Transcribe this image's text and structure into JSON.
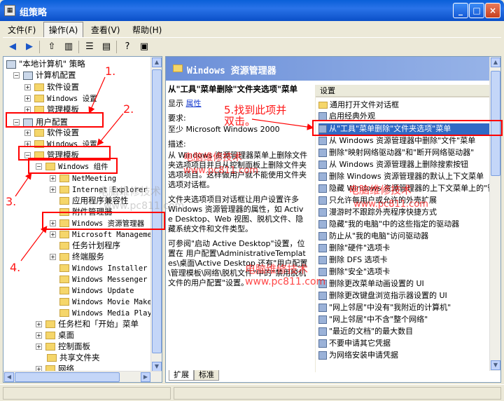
{
  "window": {
    "title": "组策略",
    "icon": "gpedit-icon",
    "min": "_",
    "max": "□",
    "close": "×"
  },
  "menu": [
    "文件(F)",
    "操作(A)",
    "查看(V)",
    "帮助(H)"
  ],
  "tree": {
    "root": "\"本地计算机\" 策略",
    "computer_config": "计算机配置",
    "software_settings_1": "软件设置",
    "windows_settings_1": "Windows 设置",
    "admin_templates_1": "管理模板",
    "user_config": "用户配置",
    "software_settings_2": "软件设置",
    "windows_settings_2": "Windows 设置",
    "admin_templates_2": "管理模板",
    "windows_components": "Windows 组件",
    "children": [
      "NetMeeting",
      "Internet Explorer",
      "应用程序兼容性",
      "附件管理器",
      "Windows 资源管理器",
      "Microsoft Management",
      "任务计划程序",
      "终端服务",
      "Windows Installer",
      "Windows Messenger",
      "Windows Update",
      "Windows Movie Maker",
      "Windows Media Player"
    ],
    "siblings": [
      "任务栏和「开始」菜单",
      "桌面",
      "控制面板",
      "共享文件夹",
      "网络"
    ]
  },
  "right": {
    "header": "Windows 资源管理器",
    "policy_title": "从\"工具\"菜单删除\"文件夹选项\"菜单",
    "show": "显示",
    "properties_link": "属性",
    "requirements_label": "要求:",
    "requirements": "至少 Microsoft Windows 2000",
    "description_label": "描述:",
    "description_1": "从 Windows 资源管理器菜单上删除文件夹选项项目并且从控制面板上删除文件夹选项项目。这样做用户就不能使用文件夹选项对话框。",
    "description_2": "文件夹选项项目对话框让用户设置许多 Windows 资源管理器的属性，如 Active Desktop、Web 视图、脱机文件、隐藏系统文件和文件类型。",
    "description_3": "可参阅\"启动 Active Desktop\"设置，位置在 用户配置\\AdministrativeTemplates\\桌面\\Active Desktop 还有\"用户配置\\管理模板\\网络\\脱机文件\"中的\"禁用脱机文件的用户配置\"设置。",
    "list_header": "设置",
    "settings": [
      "通用打开文件对话框",
      "启用经典外观",
      "从\"工具\"菜单删除\"文件夹选项\"菜单",
      "从 Windows 资源管理器中删除\"文件\"菜单",
      "删除\"映射网络驱动器\"和\"断开网络驱动器\"",
      "从 Windows 资源管理器上删除搜索按钮",
      "删除 Windows 资源管理器的默认上下文菜单",
      "隐藏 Windows 资源管理器的上下文菜单上的\"管理\"",
      "只允许每用户或允许的外壳扩展",
      "漫游时不跟踪外壳程序快捷方式",
      "隐藏\"我的电脑\"中的这些指定的驱动器",
      "防止从\"我的电脑\"访问驱动器",
      "删除\"硬件\"选项卡",
      "删除 DFS 选项卡",
      "删除\"安全\"选项卡",
      "删除更改菜单动画设置的 UI",
      "删除更改键盘浏览指示器设置的 UI",
      "\"网上邻居\"中没有\"我附近的计算机\"",
      "\"网上邻居\"中不含\"整个网络\"",
      "\"最近的文档\"的最大数目",
      "不要申请其它凭据",
      "为网络安装申请凭据"
    ],
    "tabs": [
      "扩展",
      "标准"
    ]
  },
  "annotations": {
    "step1": "1.",
    "step2": "2.",
    "step3": "3.",
    "step4": "4.",
    "step5_line1": "5.找到此项并",
    "step5_line2": "双击。"
  },
  "watermarks": {
    "w1": "电脑维修技术",
    "w2": "www.pc811.com",
    "w3": "电脑维修技术",
    "w4": "www.pc811.com",
    "w5": "电脑维修技术",
    "w6": "www.pc811.com",
    "w7": "电脑维修技术",
    "w8": "www.pc811.com"
  },
  "colors": {
    "title_bar": "#0a5fd8",
    "annotation": "#ff0000",
    "selection": "#316ac5"
  }
}
